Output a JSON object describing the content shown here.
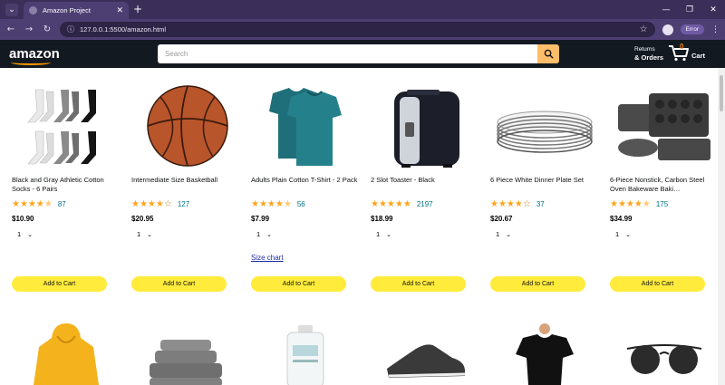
{
  "browser": {
    "tab_title": "Amazon Project",
    "url": "127.0.0.1:5500/amazon.html",
    "error_badge": "Error"
  },
  "header": {
    "logo": "amazon",
    "search_placeholder": "Search",
    "returns_line1": "Returns",
    "returns_line2": "& Orders",
    "cart_count": "0",
    "cart_label": "Cart"
  },
  "products": [
    {
      "name": "Black and Gray Athletic Cotton Socks - 6 Pairs",
      "stars": 4.5,
      "rating_count": "87",
      "price": "$10.90",
      "qty": "1"
    },
    {
      "name": "Intermediate Size Basketball",
      "stars": 4.0,
      "rating_count": "127",
      "price": "$20.95",
      "qty": "1"
    },
    {
      "name": "Adults Plain Cotton T-Shirt - 2 Pack",
      "stars": 4.5,
      "rating_count": "56",
      "price": "$7.99",
      "qty": "1",
      "size_chart": "Size chart"
    },
    {
      "name": "2 Slot Toaster - Black",
      "stars": 5.0,
      "rating_count": "2197",
      "price": "$18.99",
      "qty": "1"
    },
    {
      "name": "6 Piece White Dinner Plate Set",
      "stars": 4.0,
      "rating_count": "37",
      "price": "$20.67",
      "qty": "1"
    },
    {
      "name": "6-Piece Nonstick, Carbon Steel Oven Bakeware Baki…",
      "stars": 4.5,
      "rating_count": "175",
      "price": "$34.99",
      "qty": "1"
    }
  ],
  "add_to_cart_label": "Add to Cart",
  "row2_items": [
    "yellow-hoodie",
    "gray-towels",
    "detergent-bottle",
    "running-shoe",
    "black-tshirt",
    "sunglasses"
  ]
}
